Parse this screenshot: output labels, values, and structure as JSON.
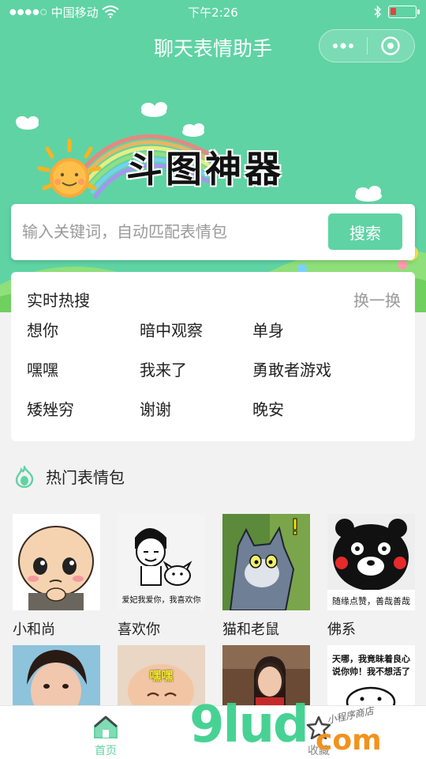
{
  "status_bar": {
    "carrier": "中国移动",
    "time": "下午2:26"
  },
  "nav": {
    "title": "聊天表情助手",
    "more_icon": "more-dots-icon",
    "close_icon": "target-circle-icon"
  },
  "banner": {
    "title": "斗图神器"
  },
  "search": {
    "placeholder": "输入关键词，自动匹配表情包",
    "button_label": "搜索"
  },
  "hot_search": {
    "title": "实时热搜",
    "refresh_label": "换一换",
    "terms": [
      "想你",
      "暗中观察",
      "单身",
      "嘿嘿",
      "我来了",
      "勇敢者游戏",
      "矮矬穷",
      "谢谢",
      "晚安"
    ]
  },
  "popular": {
    "title": "热门表情包",
    "items": [
      {
        "caption": "小和尚",
        "overlay": ""
      },
      {
        "caption": "喜欢你",
        "overlay": "爱妃我爱你，我喜欢你"
      },
      {
        "caption": "猫和老鼠",
        "overlay": ""
      },
      {
        "caption": "佛系",
        "overlay": "随缘点赞，善哉善哉"
      }
    ],
    "more_items": [
      {
        "overlay": ""
      },
      {
        "overlay": "嘿嘿"
      },
      {
        "overlay": ""
      },
      {
        "overlay": "天哪，我竟昧着良心说你帅！我不想活了"
      }
    ]
  },
  "tabbar": {
    "home_label": "首页",
    "fav_label": "收藏"
  },
  "watermark": {
    "text": "9lud",
    "suffix": "com",
    "handwriting": "小程序商店"
  },
  "colors": {
    "brand": "#5fd3a4",
    "battery_low": "#e5443a"
  }
}
